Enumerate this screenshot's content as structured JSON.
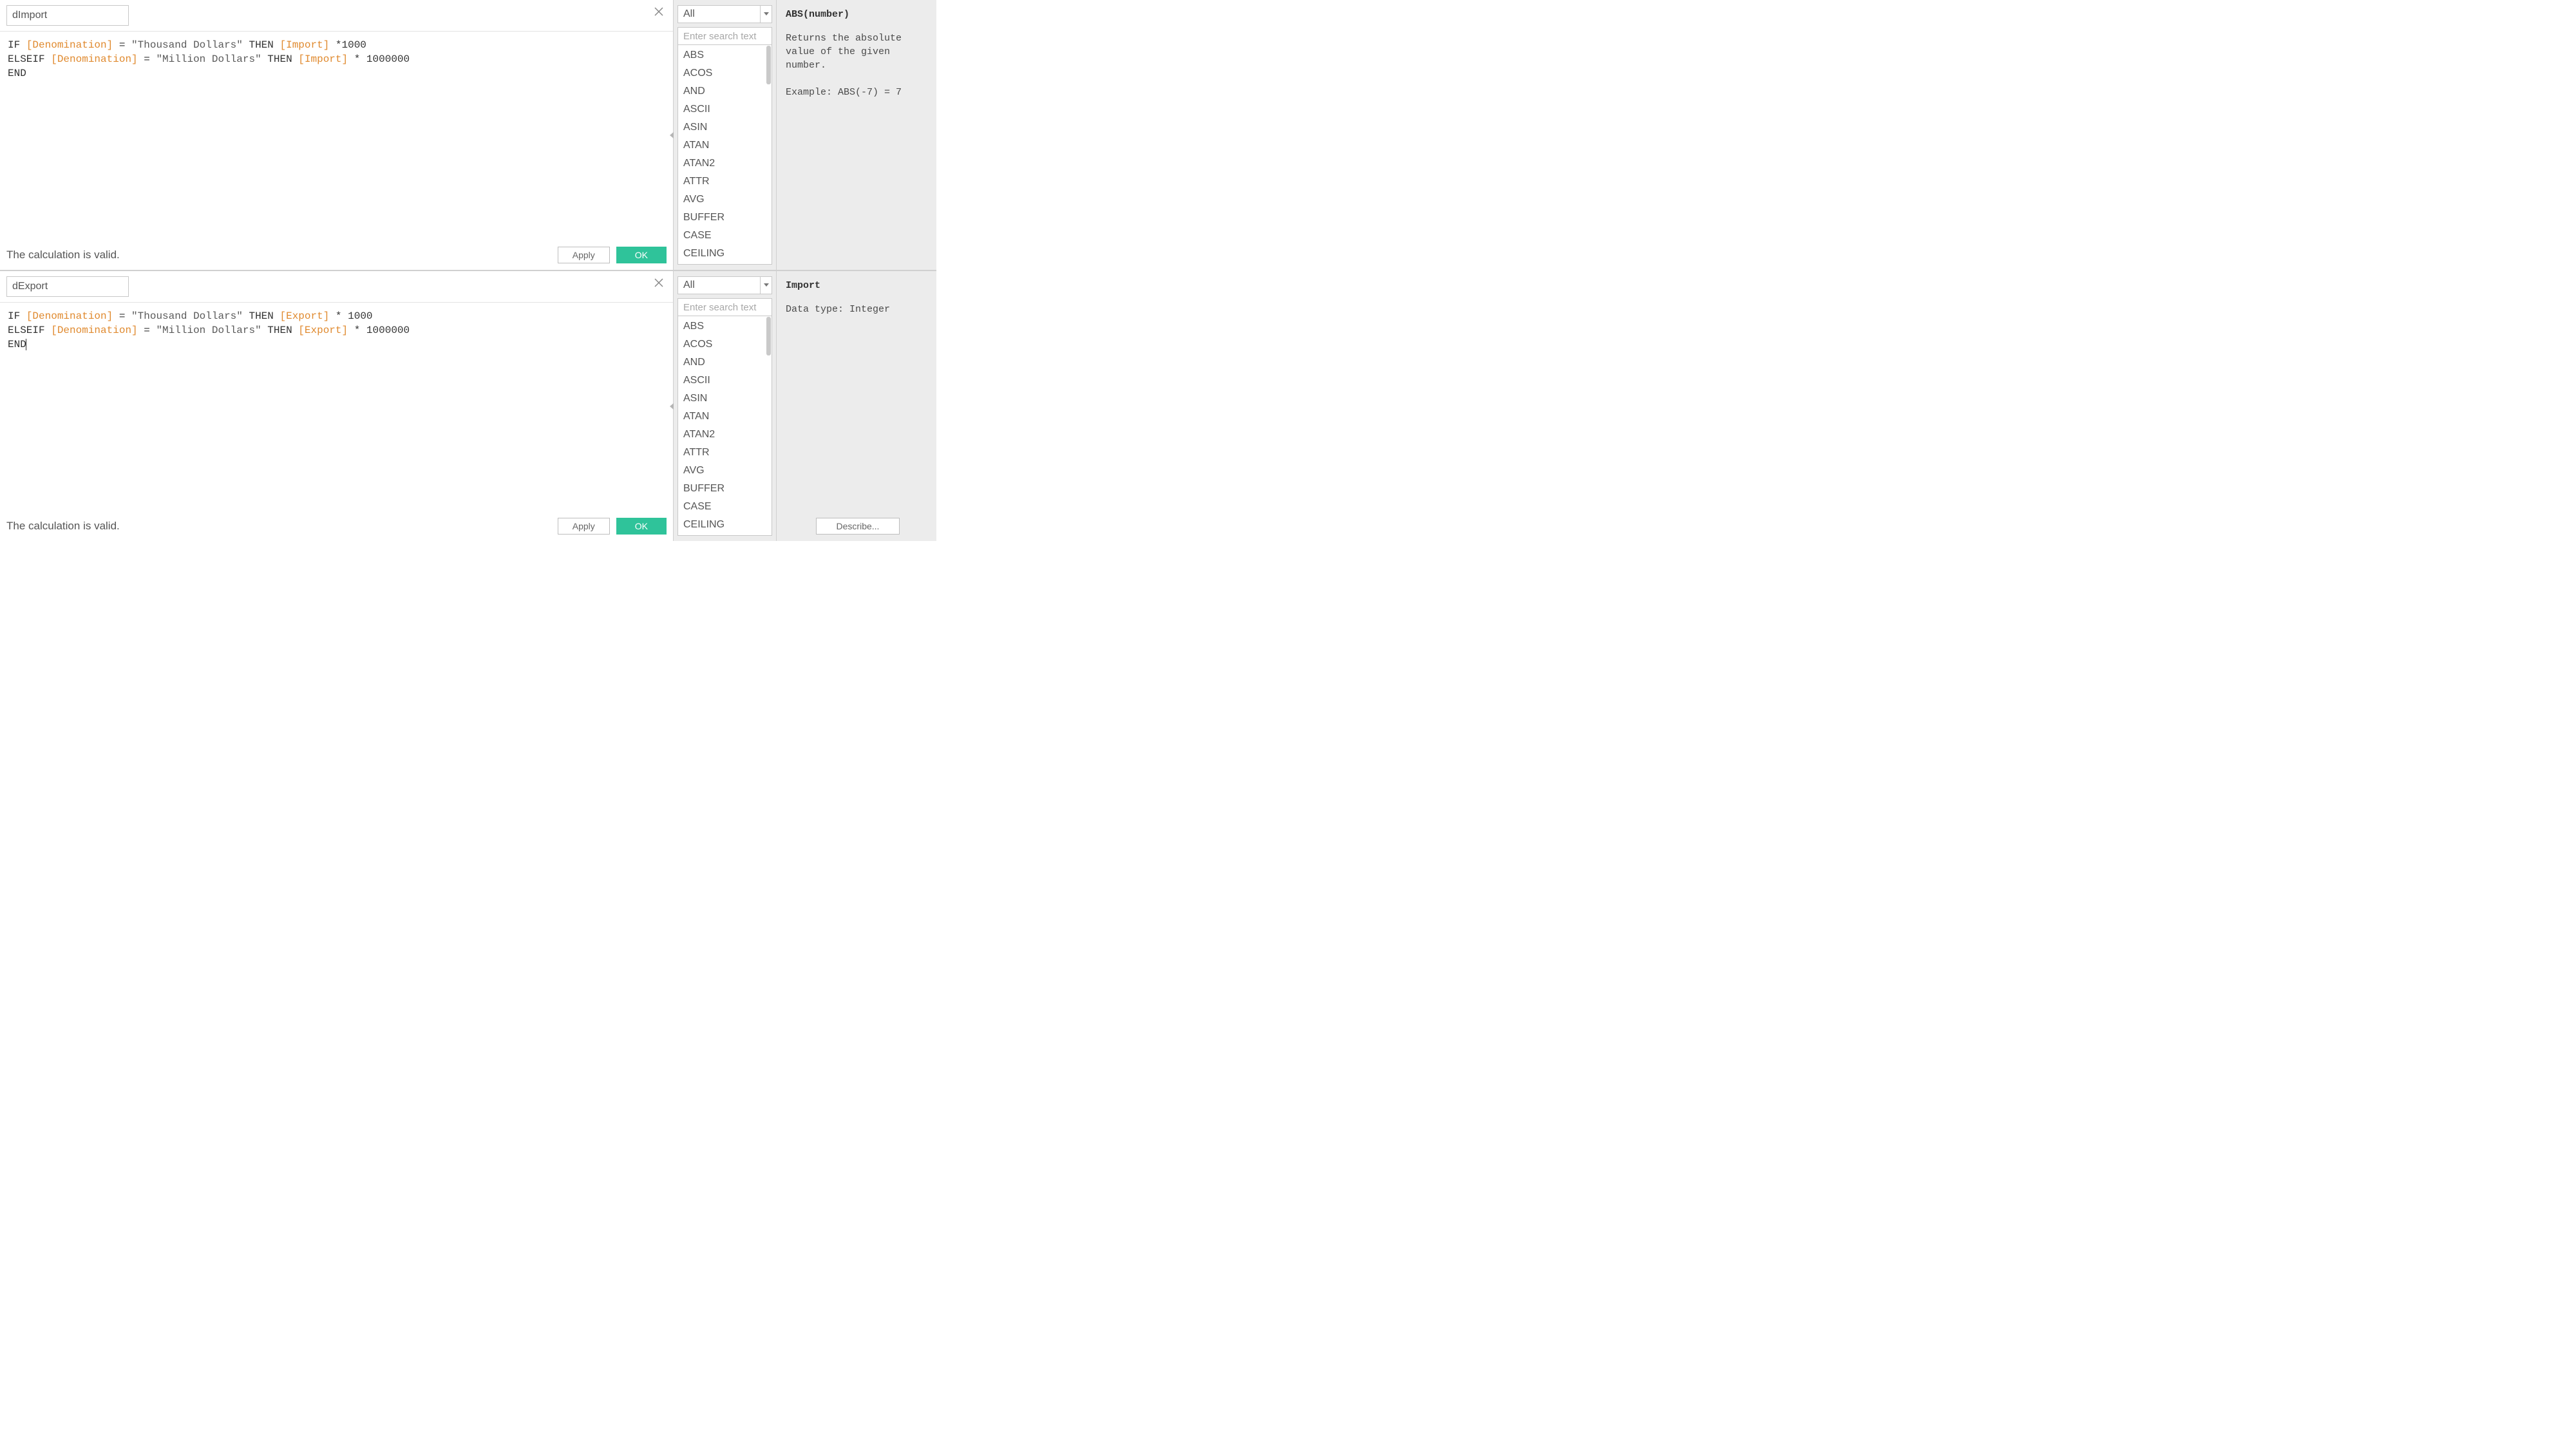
{
  "panes": [
    {
      "name": "dImport",
      "code_tokens": [
        [
          {
            "t": "kw",
            "v": "IF "
          },
          {
            "t": "field",
            "v": "[Denomination]"
          },
          {
            "t": "kw",
            "v": " = "
          },
          {
            "t": "str",
            "v": "\"Thousand Dollars\""
          },
          {
            "t": "kw",
            "v": " THEN "
          },
          {
            "t": "field",
            "v": "[Import]"
          },
          {
            "t": "kw",
            "v": " *"
          },
          {
            "t": "num",
            "v": "1000"
          }
        ],
        [
          {
            "t": "kw",
            "v": "ELSEIF "
          },
          {
            "t": "field",
            "v": "[Denomination]"
          },
          {
            "t": "kw",
            "v": " = "
          },
          {
            "t": "str",
            "v": "\"Million Dollars\""
          },
          {
            "t": "kw",
            "v": " THEN "
          },
          {
            "t": "field",
            "v": "[Import]"
          },
          {
            "t": "kw",
            "v": " * "
          },
          {
            "t": "num",
            "v": "1000000"
          }
        ],
        [
          {
            "t": "kw",
            "v": "END"
          }
        ]
      ],
      "status": "The calculation is valid.",
      "apply": "Apply",
      "ok": "OK",
      "category": "All",
      "search_placeholder": "Enter search text",
      "functions": [
        "ABS",
        "ACOS",
        "AND",
        "ASCII",
        "ASIN",
        "ATAN",
        "ATAN2",
        "ATTR",
        "AVG",
        "BUFFER",
        "CASE",
        "CEILING"
      ],
      "doc_title": "ABS(number)",
      "doc_body": "Returns the absolute value of the given number.\n\nExample: ABS(-7) = 7",
      "show_describe": false,
      "show_cursor": false
    },
    {
      "name": "dExport",
      "code_tokens": [
        [
          {
            "t": "kw",
            "v": "IF "
          },
          {
            "t": "field",
            "v": "[Denomination]"
          },
          {
            "t": "kw",
            "v": " = "
          },
          {
            "t": "str",
            "v": "\"Thousand Dollars\""
          },
          {
            "t": "kw",
            "v": " THEN "
          },
          {
            "t": "field",
            "v": "[Export]"
          },
          {
            "t": "kw",
            "v": " * "
          },
          {
            "t": "num",
            "v": "1000"
          }
        ],
        [
          {
            "t": "kw",
            "v": "ELSEIF "
          },
          {
            "t": "field",
            "v": "[Denomination]"
          },
          {
            "t": "kw",
            "v": " = "
          },
          {
            "t": "str",
            "v": "\"Million Dollars\""
          },
          {
            "t": "kw",
            "v": " THEN "
          },
          {
            "t": "field",
            "v": "[Export]"
          },
          {
            "t": "kw",
            "v": " * "
          },
          {
            "t": "num",
            "v": "1000000"
          }
        ],
        [
          {
            "t": "kw",
            "v": "END"
          }
        ]
      ],
      "status": "The calculation is valid.",
      "apply": "Apply",
      "ok": "OK",
      "category": "All",
      "search_placeholder": "Enter search text",
      "functions": [
        "ABS",
        "ACOS",
        "AND",
        "ASCII",
        "ASIN",
        "ATAN",
        "ATAN2",
        "ATTR",
        "AVG",
        "BUFFER",
        "CASE",
        "CEILING"
      ],
      "doc_title": "Import",
      "doc_body": "Data type: Integer",
      "show_describe": true,
      "describe_label": "Describe...",
      "show_cursor": true
    }
  ]
}
